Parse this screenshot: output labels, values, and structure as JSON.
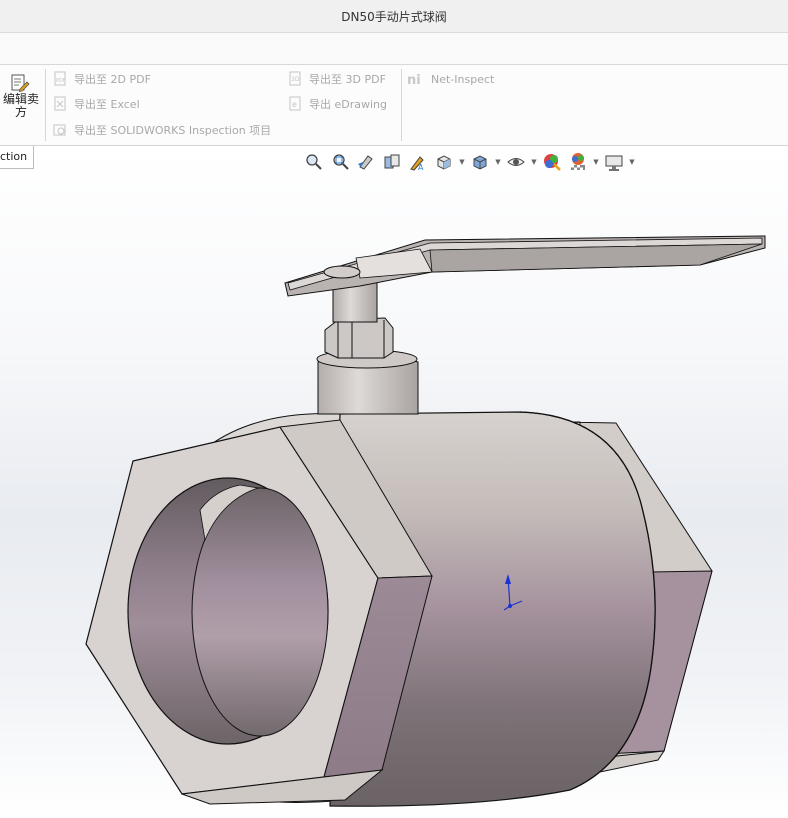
{
  "window": {
    "title": "DN50手动片式球阀"
  },
  "ribbon": {
    "edit_button": {
      "label": "编辑卖方",
      "icon": "edit-document-icon"
    },
    "commands": [
      {
        "id": "export-2d-pdf",
        "label": "导出至 2D PDF",
        "icon": "pdf-export-icon",
        "enabled": false
      },
      {
        "id": "export-excel",
        "label": "导出至 Excel",
        "icon": "excel-export-icon",
        "enabled": false
      },
      {
        "id": "export-inspection",
        "label": "导出至 SOLIDWORKS Inspection 项目",
        "icon": "inspection-export-icon",
        "enabled": false
      },
      {
        "id": "export-3d-pdf",
        "label": "导出至 3D PDF",
        "icon": "3d-pdf-export-icon",
        "enabled": false
      },
      {
        "id": "export-edrawing",
        "label": "导出 eDrawing",
        "icon": "edrawing-export-icon",
        "enabled": false
      },
      {
        "id": "net-inspect",
        "label": "Net-Inspect",
        "icon": "net-inspect-icon",
        "enabled": false
      }
    ]
  },
  "tabs": {
    "active_label": "ction"
  },
  "view_toolbar": [
    "zoom-to-fit-icon",
    "zoom-to-area-icon",
    "previous-view-icon",
    "section-view-icon",
    "dynamic-annotation-icon",
    "view-orientation-icon",
    "display-style-icon",
    "hide-show-items-icon",
    "edit-appearance-icon",
    "apply-scene-icon",
    "view-settings-icon"
  ],
  "colors": {
    "part_light": "#d9d4d1",
    "part_mid": "#c5bebb",
    "part_purple": "#9e8a98",
    "part_dark": "#6c6467",
    "triad": "#1a33d6"
  }
}
